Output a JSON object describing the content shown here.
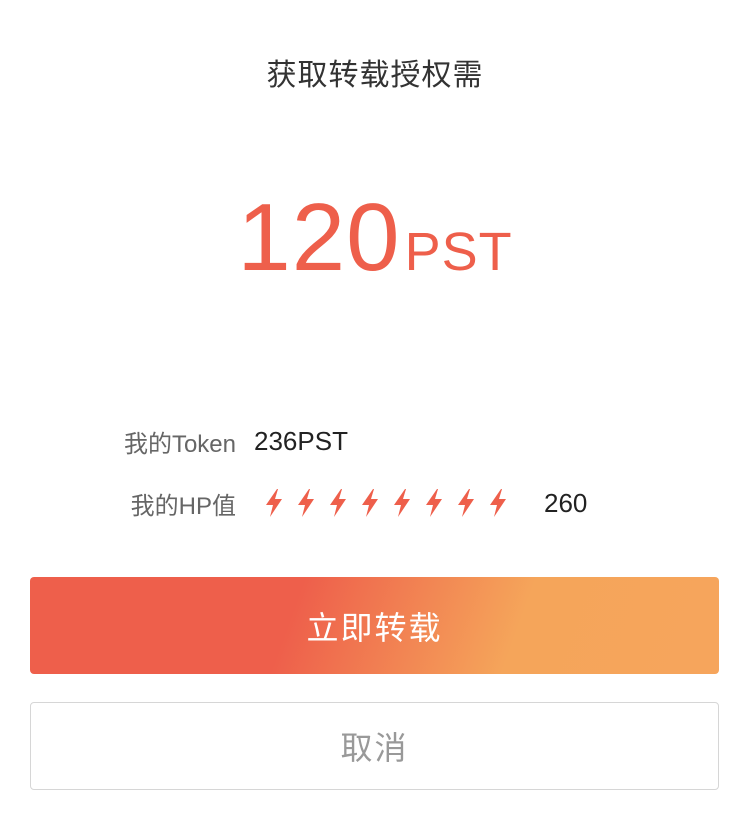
{
  "dialog": {
    "title": "获取转载授权需",
    "price_amount": "120",
    "price_unit": "PST"
  },
  "wallet": {
    "token_label": "我的Token",
    "token_value": "236PST",
    "hp_label": "我的HP值",
    "hp_bolt_count": 8,
    "hp_value": "260"
  },
  "actions": {
    "confirm_label": "立即转载",
    "cancel_label": "取消"
  },
  "colors": {
    "accent": "#ee5f4b",
    "gradient_end": "#f6a55c"
  },
  "icons": {
    "hp_bolt": "lightning-bolt-icon"
  }
}
